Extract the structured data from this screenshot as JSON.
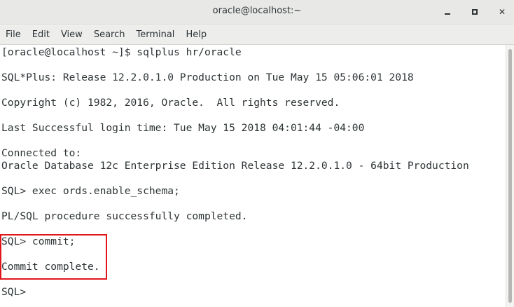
{
  "window": {
    "title": "oracle@localhost:~",
    "controls": {
      "minimize": "minimize-icon",
      "maximize": "maximize-icon",
      "close": "close-icon",
      "close_glyph": "✕"
    }
  },
  "menu": {
    "items": [
      "File",
      "Edit",
      "View",
      "Search",
      "Terminal",
      "Help"
    ]
  },
  "terminal": {
    "lines": [
      "[oracle@localhost ~]$ sqlplus hr/oracle",
      "",
      "SQL*Plus: Release 12.2.0.1.0 Production on Tue May 15 05:06:01 2018",
      "",
      "Copyright (c) 1982, 2016, Oracle.  All rights reserved.",
      "",
      "Last Successful login time: Tue May 15 2018 04:01:44 -04:00",
      "",
      "Connected to:",
      "Oracle Database 12c Enterprise Edition Release 12.2.0.1.0 - 64bit Production",
      "",
      "SQL> exec ords.enable_schema;",
      "",
      "PL/SQL procedure successfully completed.",
      "",
      "SQL> commit;",
      "",
      "Commit complete.",
      "",
      "SQL>"
    ]
  },
  "annotation": {
    "highlight_color": "#e0161b"
  }
}
